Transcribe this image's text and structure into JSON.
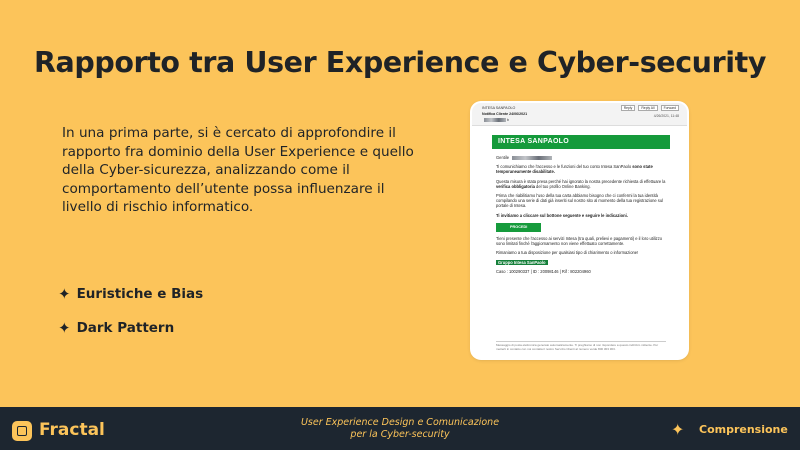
{
  "slide": {
    "title": "Rapporto tra User Experience e Cyber-security",
    "intro": "In una prima parte, si è cercato di approfondire il rapporto fra dominio della User Experience e quello della Cyber-sicurezza, analizzando come il comportamento dell’utente possa influenzare il livello di rischio informatico.",
    "bullets": [
      "Euristiche e Bias",
      "Dark Pattern"
    ],
    "bullet_icon": "✦"
  },
  "email": {
    "from": "INTESA SANPAOLO",
    "subject": "Notifica Cliente 24/06/2021",
    "to": "b",
    "actions": [
      "Reply",
      "Reply All",
      "Forward"
    ],
    "date": "4/26/2021, 11:48",
    "brand": "INTESA SANPAOLO",
    "greeting": "Gentile",
    "p1_pre": "Ti comunichiamo che l'accesso e le funzioni del tuo conto Intesa SanPaolo ",
    "p1_bold": "sono state temporaneamente disabilitate.",
    "p2_pre": "Questa misura è stata presa perché hai ignorato la nostra precedente richiesta di effettuare la ",
    "p2_bold": "verifica obbligatoria",
    "p2_post": " del tuo profilo Online Banking.",
    "p3": "Prima che riabilitiamo l'uso della tua carta abbiamo bisogno che ci confermi la tua identità compilando una serie di dati già inseriti sul nostro sito al momento della tua registrazione sul portale di Intesa.",
    "p4": "Ti invitiamo a cliccare sul bottone seguente e seguire le indicazioni.",
    "button": "PROCEDI",
    "p5": "Tieni presente che l'accesso ai servizi Intesa (tra quali, prelievi e pagamenti) e il loro utilizzo sono limitati finché l'aggiornamento non viene effettuato correttamente.",
    "p6": "Rimaniamo a tua disposizione per qualsiasi tipo di chiarimento o informazione!",
    "signature": "Gruppo Intesa SanPaolo",
    "case": "Caso : 100290337 | ID : 20098146 | Rif : 802204960",
    "footer_note": "Messaggio di posta elettronica generato automaticamente. Ti preghiamo di non rispondere a questo indirizzo mittente. Per metterti in contatto con noi contatta il nostro Servizio Clienti al numero verde 800 303 303."
  },
  "footer": {
    "brand": "Fractal",
    "course_line1": "User Experience Design e Comunicazione",
    "course_line2": "per la Cyber-security",
    "section_icon": "✦",
    "section": "Comprensione"
  },
  "colors": {
    "background": "#fcc45a",
    "footer": "#1d2630",
    "accent": "#fcc45a",
    "intesa_green": "#159a3b"
  }
}
